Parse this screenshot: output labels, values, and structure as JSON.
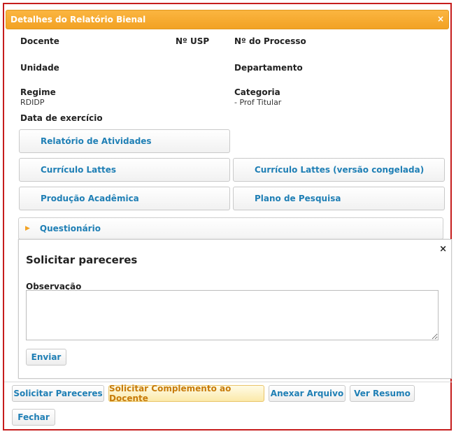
{
  "window": {
    "title": "Detalhes do Relatório Bienal",
    "close": "×"
  },
  "fields": {
    "docente_label": "Docente",
    "nusp_label": "Nº USP",
    "processo_label": "Nº do Processo",
    "unidade_label": "Unidade",
    "departamento_label": "Departamento",
    "regime_label": "Regime",
    "regime_value": "RDIDP",
    "categoria_label": "Categoria",
    "categoria_value": "- Prof Titular",
    "data_exercicio_label": "Data de exercício"
  },
  "links": {
    "relatorio": "Relatório de Atividades",
    "curriculo": "Currículo Lattes",
    "curriculo_congelado": "Currículo Lattes (versão congelada)",
    "producao": "Produção Acadêmica",
    "plano": "Plano de Pesquisa"
  },
  "accordion": {
    "label": "Questionário"
  },
  "dialog": {
    "close": "×",
    "title": "Solicitar pareceres",
    "observacao_label": "Observação",
    "send_label": "Enviar"
  },
  "footer": {
    "solicitar_pareceres": "Solicitar Pareceres",
    "solicitar_complemento": "Solicitar Complemento ao Docente",
    "anexar": "Anexar Arquivo",
    "ver_resumo": "Ver Resumo",
    "fechar": "Fechar"
  },
  "colors": {
    "titlebar": "#f2a224",
    "frame": "#c61d1d",
    "link": "#1f7fb5",
    "highlight": "#c77b0a"
  }
}
